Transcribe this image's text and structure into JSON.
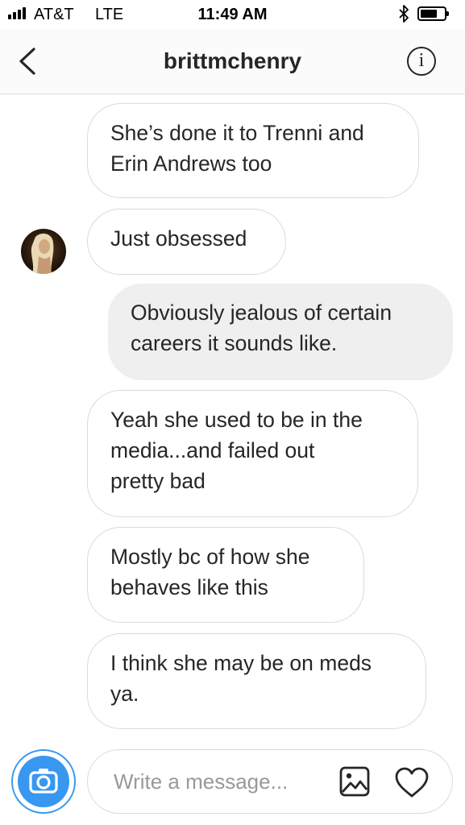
{
  "status_bar": {
    "carrier": "AT&T",
    "network": "LTE",
    "time": "11:49 AM",
    "icons": [
      "signal-bars-icon",
      "bluetooth-icon",
      "battery-icon"
    ]
  },
  "nav": {
    "back_icon": "chevron-left-icon",
    "title": "brittmchenry",
    "info_label": "i"
  },
  "messages": [
    {
      "direction": "incoming",
      "lines": [
        "She’s done it to Trenni and",
        "Erin Andrews too"
      ]
    },
    {
      "direction": "incoming",
      "lines": [
        "Just obsessed"
      ],
      "avatar": true
    },
    {
      "direction": "outgoing",
      "lines": [
        "Obviously jealous of certain",
        "careers it sounds like."
      ]
    },
    {
      "direction": "incoming",
      "lines": [
        "Yeah she used to be in the",
        "media...and failed out",
        "pretty bad"
      ]
    },
    {
      "direction": "incoming",
      "lines": [
        "Mostly bc of how she",
        "behaves like this"
      ]
    },
    {
      "direction": "incoming",
      "lines": [
        "I think she may be on meds",
        "ya."
      ]
    }
  ],
  "composer": {
    "placeholder": "Write a message...",
    "value": "",
    "camera_icon": "camera-icon",
    "gallery_icon": "gallery-icon",
    "heart_icon": "heart-icon"
  },
  "colors": {
    "accent": "#3897f0",
    "outgoing_bubble": "#efefef",
    "incoming_border": "#dbdbdb",
    "text": "#262626"
  }
}
